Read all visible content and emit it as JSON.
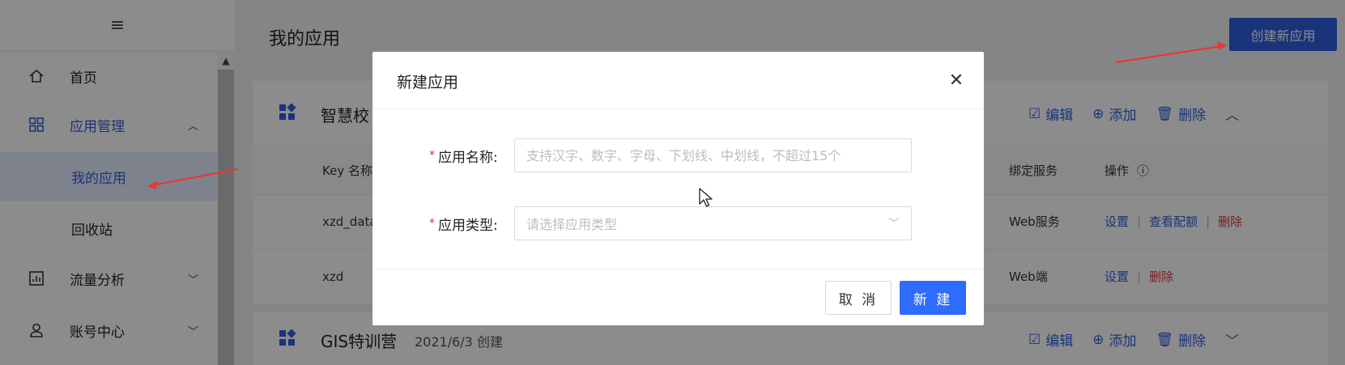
{
  "sidebar": {
    "menu_glyph": "≡",
    "items": [
      {
        "label": "首页",
        "icon": "home-icon"
      },
      {
        "label": "应用管理",
        "icon": "grid-icon"
      },
      {
        "label": "我的应用"
      },
      {
        "label": "回收站"
      },
      {
        "label": "流量分析",
        "icon": "chart-icon"
      },
      {
        "label": "账号中心",
        "icon": "user-icon"
      }
    ]
  },
  "main": {
    "title": "我的应用",
    "create_button": "创建新应用",
    "cards": [
      {
        "title": "智慧校",
        "date": "",
        "actions": {
          "edit": "编辑",
          "add": "添加",
          "delete": "删除"
        },
        "table": {
          "headers": {
            "key": "Key 名称",
            "service": "绑定服务",
            "ops": "操作"
          },
          "rows": [
            {
              "key": "xzd_data",
              "service": "Web服务",
              "ops": [
                "设置",
                "查看配额",
                "删除"
              ]
            },
            {
              "key": "xzd",
              "service": "Web端",
              "ops": [
                "设置",
                "删除"
              ]
            }
          ]
        }
      },
      {
        "title": "GIS特训营",
        "date": "2021/6/3 创建",
        "actions": {
          "edit": "编辑",
          "add": "添加",
          "delete": "删除"
        }
      }
    ]
  },
  "modal": {
    "title": "新建应用",
    "fields": {
      "name": {
        "label": "应用名称:",
        "placeholder": "支持汉字、数字、字母、下划线、中划线，不超过15个"
      },
      "type": {
        "label": "应用类型:",
        "placeholder": "请选择应用类型"
      }
    },
    "cancel": "取 消",
    "submit": "新 建"
  },
  "colors": {
    "primary": "#2f5fe0",
    "danger": "#d9363e",
    "annotation": "#e53935"
  }
}
